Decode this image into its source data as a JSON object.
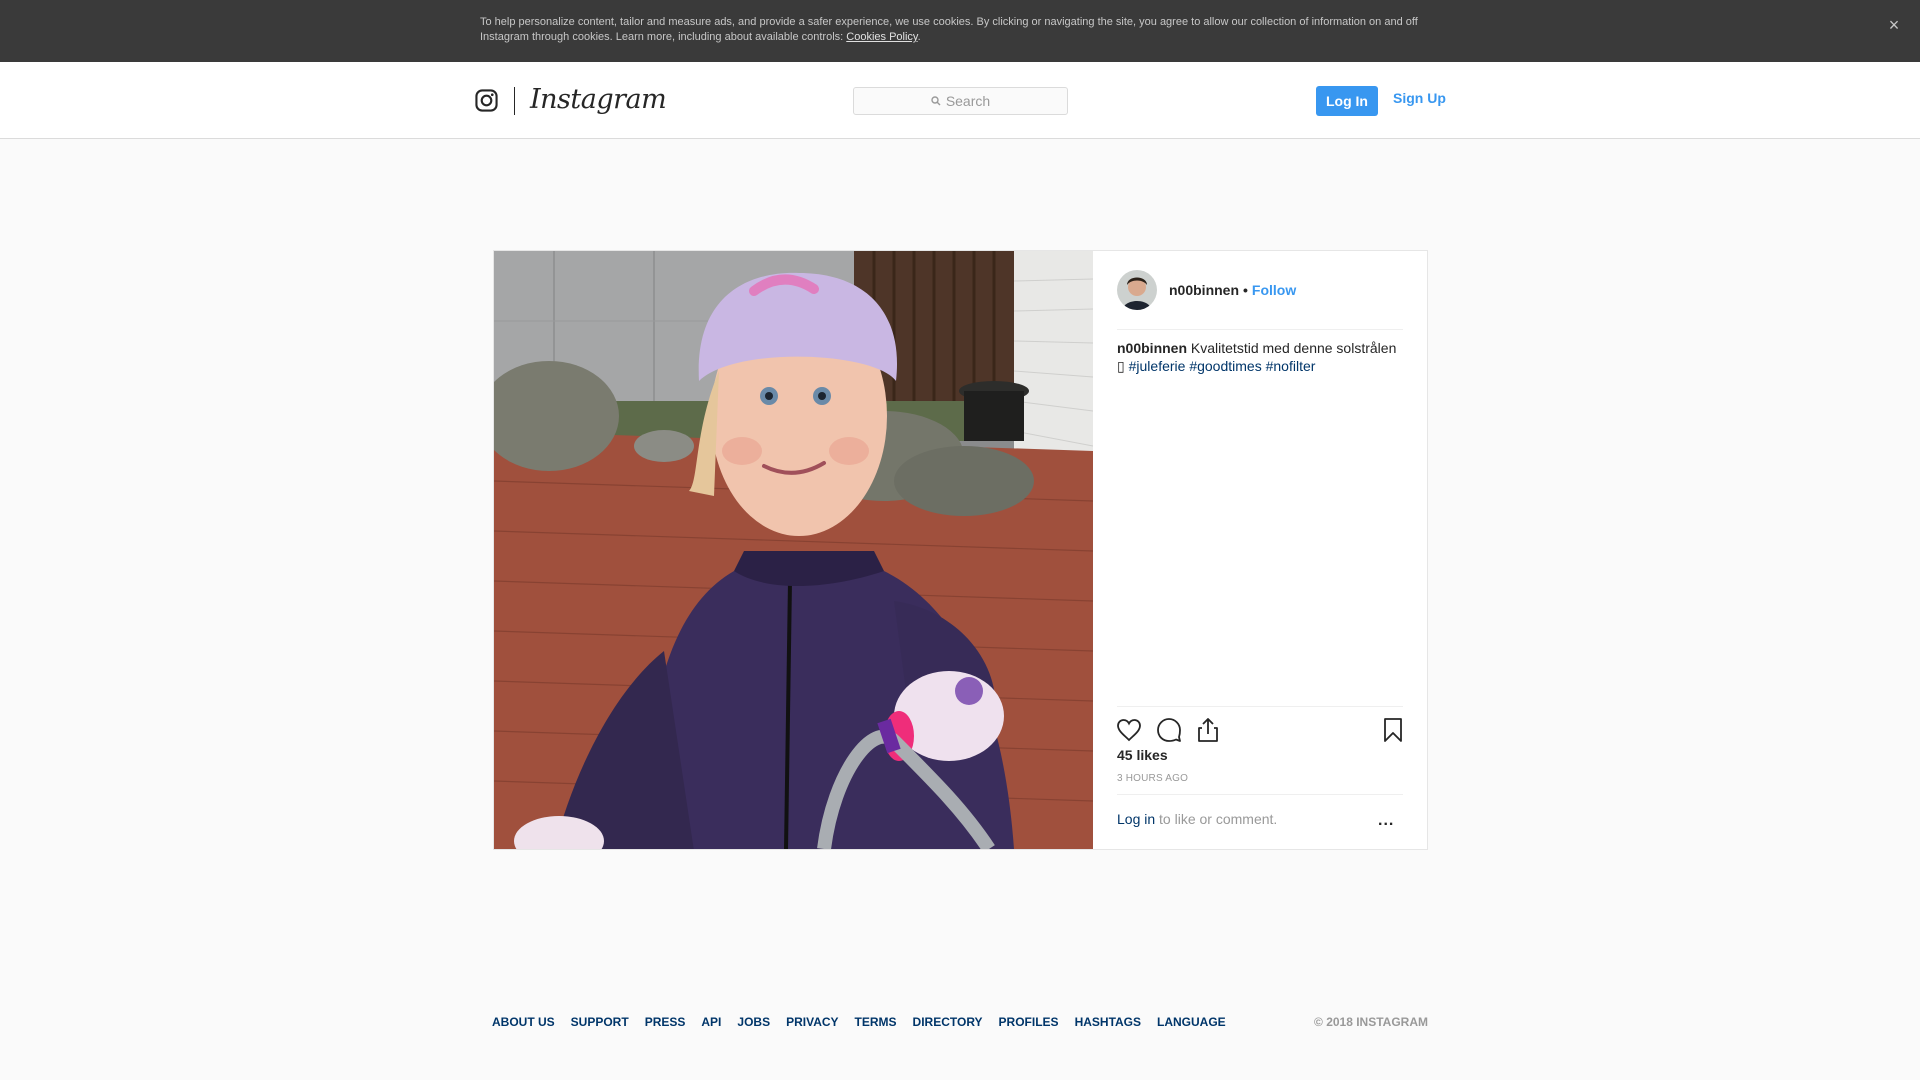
{
  "cookie_banner": {
    "text": "To help personalize content, tailor and measure ads, and provide a safer experience, we use cookies. By clicking or navigating the site, you agree to allow our collection of information on and off Instagram through cookies. Learn more, including about available controls: ",
    "link": "Cookies Policy",
    "after_link": ".",
    "close_icon": "×"
  },
  "header": {
    "wordmark": "Instagram",
    "search_placeholder": "Search",
    "login_label": "Log In",
    "signup_label": "Sign Up"
  },
  "post": {
    "username": "n00binnen",
    "separator": "•",
    "follow_label": "Follow",
    "caption_user": "n00binnen",
    "caption_text": "Kvalitetstid med denne solstrålen",
    "caption_glyph": "▯",
    "hashtags": [
      "#juleferie",
      "#goodtimes",
      "#nofilter"
    ],
    "likes": "45 likes",
    "time": "3 HOURS AGO",
    "login_link": "Log in",
    "login_suffix": " to like or comment.",
    "more": "..."
  },
  "icons": {
    "logo": "instagram-camera-icon",
    "search": "search-icon",
    "like": "heart-icon",
    "comment": "comment-icon",
    "share": "share-icon",
    "save": "bookmark-icon"
  },
  "footer": {
    "links": [
      "ABOUT US",
      "SUPPORT",
      "PRESS",
      "API",
      "JOBS",
      "PRIVACY",
      "TERMS",
      "DIRECTORY",
      "PROFILES",
      "HASHTAGS",
      "LANGUAGE"
    ],
    "copyright": "© 2018 INSTAGRAM"
  },
  "colors": {
    "accent": "#3897f0",
    "link": "#003569",
    "banner": "#3a3a3a"
  }
}
